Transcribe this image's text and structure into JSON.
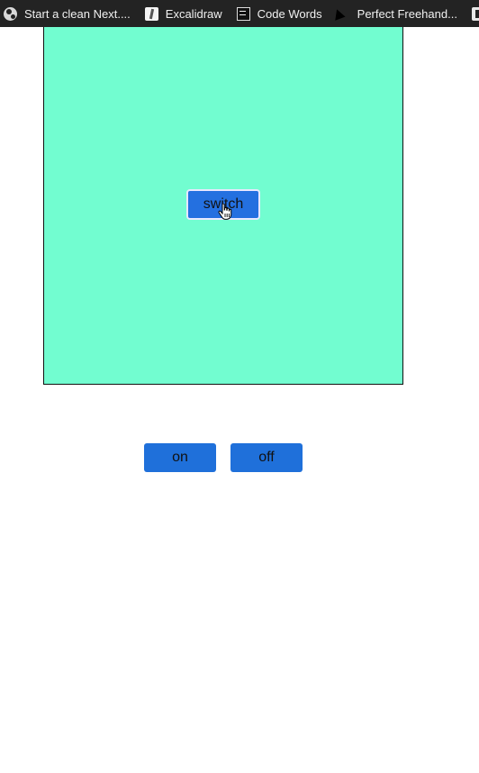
{
  "bookmarks": [
    {
      "label": "Start a clean Next....",
      "icon": "globe-icon"
    },
    {
      "label": "Excalidraw",
      "icon": "excalidraw-icon"
    },
    {
      "label": "Code Words",
      "icon": "code-words-icon"
    },
    {
      "label": "Perfect Freehand...",
      "icon": "perfect-freehand-icon"
    }
  ],
  "canvas": {
    "background": "#72fdd0",
    "switch_label": "switch"
  },
  "controls": {
    "on_label": "on",
    "off_label": "off",
    "button_color": "#1f70da"
  }
}
